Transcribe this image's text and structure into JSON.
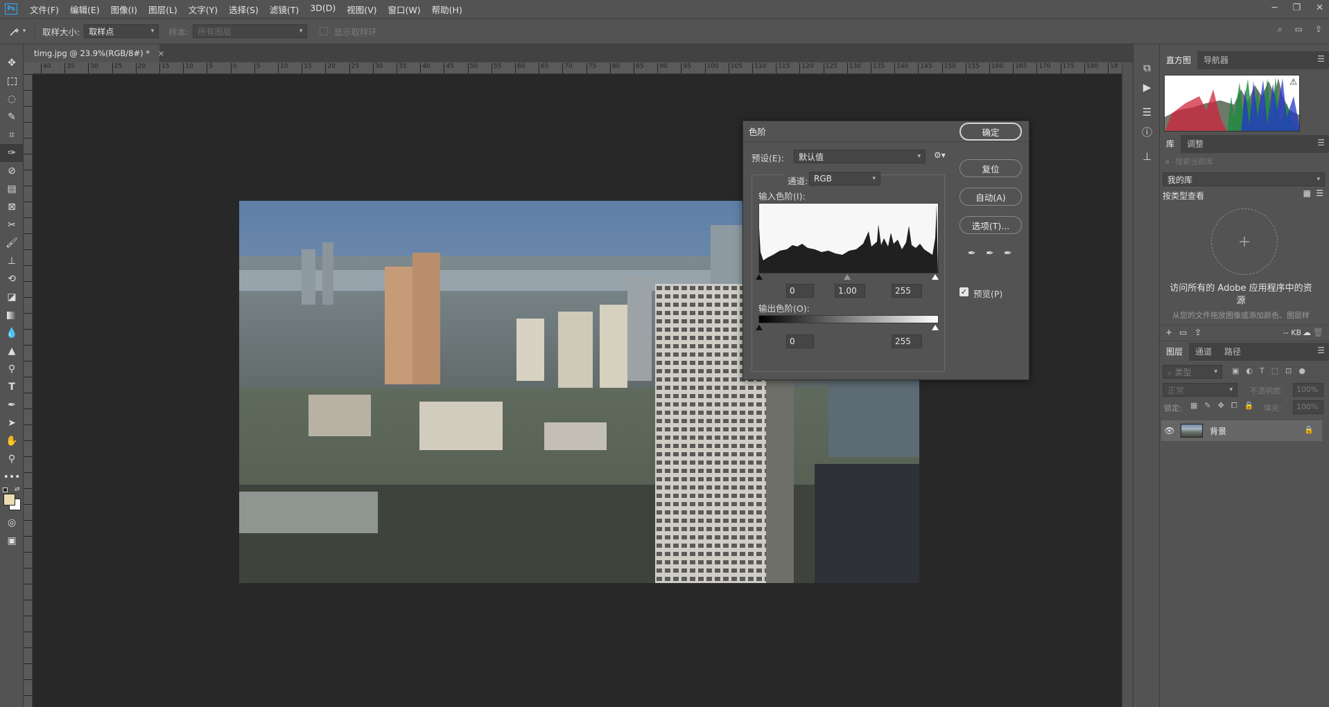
{
  "app": {
    "logo": "Ps"
  },
  "menu": [
    "文件(F)",
    "编辑(E)",
    "图像(I)",
    "图层(L)",
    "文字(Y)",
    "选择(S)",
    "滤镜(T)",
    "3D(D)",
    "视图(V)",
    "窗口(W)",
    "帮助(H)"
  ],
  "options": {
    "sample_size_label": "取样大小:",
    "sample_size_value": "取样点",
    "sample_label": "样本:",
    "sample_value": "所有图层",
    "show_ring_label": "显示取样环"
  },
  "document": {
    "tab_title": "timg.jpg @ 23.9%(RGB/8#) *",
    "close": "×"
  },
  "ruler": {
    "top": [
      "40",
      "35",
      "30",
      "25",
      "20",
      "15",
      "10",
      "5",
      "0",
      "5",
      "10",
      "15",
      "20",
      "25",
      "30",
      "35",
      "40",
      "45",
      "50",
      "55",
      "60",
      "65",
      "70",
      "75",
      "80",
      "85",
      "90",
      "95",
      "100",
      "105",
      "110",
      "115",
      "120",
      "125",
      "130",
      "135",
      "140",
      "145",
      "150",
      "155",
      "160",
      "165",
      "170",
      "175",
      "180",
      "18"
    ]
  },
  "levels_dialog": {
    "title": "色阶",
    "preset_label": "预设(E):",
    "preset_value": "默认值",
    "channel_label": "通道:",
    "channel_value": "RGB",
    "input_label": "输入色阶(I):",
    "input_black": "0",
    "input_gamma": "1.00",
    "input_white": "255",
    "output_label": "输出色阶(O):",
    "output_black": "0",
    "output_white": "255",
    "ok": "确定",
    "reset": "复位",
    "auto": "自动(A)",
    "options": "选项(T)...",
    "preview_label": "预览(P)",
    "preview_checked": true
  },
  "histogram_panel": {
    "tabs": [
      "直方图",
      "导航器"
    ]
  },
  "library_panel": {
    "tabs": [
      "库",
      "调整"
    ],
    "search_placeholder": "搜索当前库",
    "library_select": "我的库",
    "view_by": "按类型查看",
    "promo_title": "访问所有的 Adobe 应用程序中的资源",
    "promo_sub": "从您的文件拖放图像或添加颜色、图层样式和其他资源",
    "size": "-- KB"
  },
  "layers_panel": {
    "tabs": [
      "图层",
      "通道",
      "路径"
    ],
    "filter_placeholder": "类型",
    "blend_mode": "正常",
    "opacity_label": "不透明度:",
    "opacity_value": "100%",
    "lock_label": "锁定:",
    "fill_label": "填充:",
    "fill_value": "100%",
    "layers": [
      {
        "name": "背景",
        "visible": true,
        "locked": true
      }
    ]
  },
  "colors": {
    "accent": "#31a8ff",
    "canvas_bg": "#282828",
    "panel_bg": "#535353"
  }
}
